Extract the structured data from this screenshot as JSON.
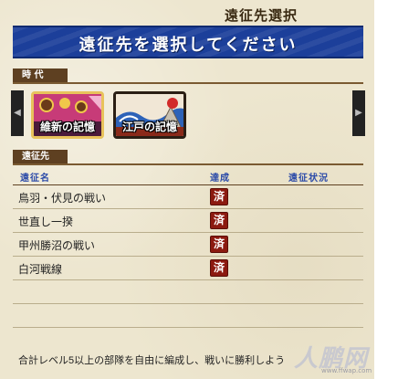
{
  "header": {
    "corner_title": "遠征先選択",
    "banner": "遠征先を選択してください"
  },
  "era_section": {
    "label": "時 代",
    "cards": [
      {
        "label": "維新の記憶",
        "theme": "ishin",
        "color": "#c73b78"
      },
      {
        "label": "江戸の記憶",
        "theme": "edo",
        "color": "#2d62b8"
      }
    ],
    "prev_arrow": "◀",
    "next_arrow": "▶"
  },
  "expedition_section": {
    "label": "遠征先",
    "columns": {
      "name": "遠征名",
      "achieved": "達成",
      "status": "遠征状況"
    },
    "rows": [
      {
        "name": "鳥羽・伏見の戦い",
        "achieved": "済",
        "status": ""
      },
      {
        "name": "世直し一揆",
        "achieved": "済",
        "status": ""
      },
      {
        "name": "甲州勝沼の戦い",
        "achieved": "済",
        "status": ""
      },
      {
        "name": "白河戦線",
        "achieved": "済",
        "status": ""
      }
    ]
  },
  "footer": {
    "text": "合計レベル5以上の部隊を自由に編成し、戦いに勝利しよう"
  },
  "watermark": {
    "text": "人鹏网",
    "url": "www.ffwap.com"
  },
  "colors": {
    "banner_blue": "#1c3f9a",
    "tab_brown": "#5e4021",
    "stamp_red": "#8c1a10",
    "column_blue": "#2b4aa8"
  }
}
